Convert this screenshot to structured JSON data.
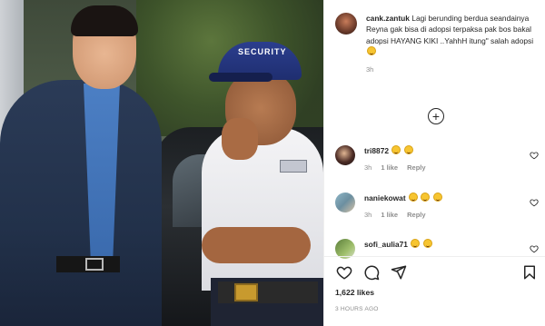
{
  "photo": {
    "cap_text": "SECURITY"
  },
  "caption": {
    "username": "cank.zantuk",
    "text": "Lagi berunding berdua seandainya Reyna gak bisa di adopsi terpaksa pak bos bakal adopsi HAYANG KIKI ..YahhH itung\" salah adopsi",
    "time": "3h"
  },
  "load_more_icon": "plus-circle-icon",
  "comments": [
    {
      "username": "tri8872",
      "time": "3h",
      "likes": "1 like",
      "reply": "Reply",
      "emoji_count": 2
    },
    {
      "username": "naniekowat",
      "time": "3h",
      "likes": "1 like",
      "reply": "Reply",
      "emoji_count": 3
    },
    {
      "username": "sofi_aulia71",
      "time": "",
      "likes": "",
      "reply": "",
      "emoji_count": 2
    }
  ],
  "actions": {
    "icons": [
      "heart-icon",
      "comment-icon",
      "share-icon",
      "bookmark-icon"
    ]
  },
  "likes_count": "1,622 likes",
  "posted_time": "3 HOURS AGO",
  "colors": {
    "text": "#262626",
    "meta": "#8e8e8e",
    "divider": "#efefef"
  }
}
